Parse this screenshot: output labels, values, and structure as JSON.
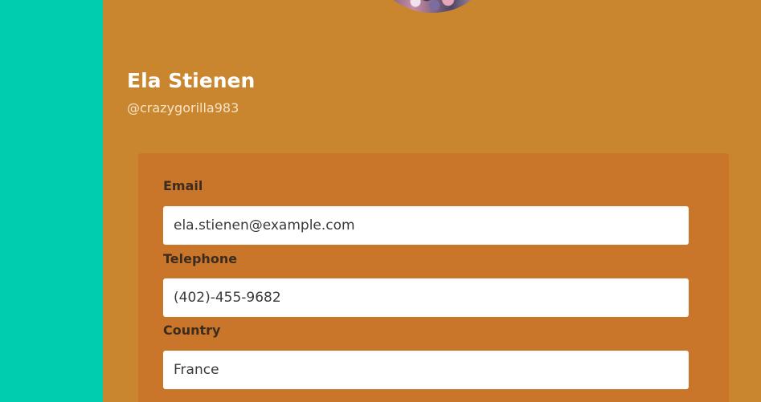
{
  "profile": {
    "name": "Ela Stienen",
    "handle": "@crazygorilla983"
  },
  "contact": {
    "email_label": "Email",
    "email_value": "ela.stienen@example.com",
    "telephone_label": "Telephone",
    "telephone_value": "(402)-455-9682",
    "country_label": "Country",
    "country_value": "France"
  },
  "colors": {
    "sidebar": "#00cdb0",
    "page": "#c9862e",
    "card": "#c9762a"
  }
}
